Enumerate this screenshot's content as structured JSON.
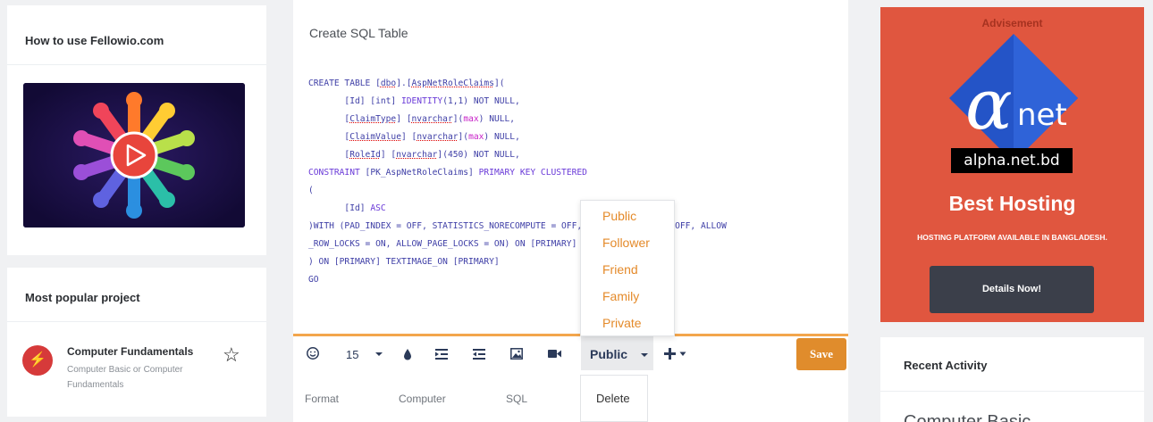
{
  "left": {
    "howto_title": "How to use Fellowio.com",
    "popular_title": "Most popular project",
    "project": {
      "icon": "bolt-icon",
      "title": "Computer Fundamentals",
      "subtitle": "Computer Basic or Computer Fundamentals"
    }
  },
  "editor": {
    "title": "Create  SQL Table",
    "code_lines": [
      "CREATE TABLE [dbo].[AspNetRoleClaims](",
      "       [Id] [int] IDENTITY(1,1) NOT NULL,",
      "       [ClaimType] [nvarchar](max) NULL,",
      "       [ClaimValue] [nvarchar](max) NULL,",
      "       [RoleId] [nvarchar](450) NOT NULL,",
      "CONSTRAINT [PK_AspNetRoleClaims] PRIMARY KEY CLUSTERED",
      "(",
      "       [Id] ASC",
      ")WITH (PAD_INDEX = OFF, STATISTICS_NORECOMPUTE = OFF, IGNORE_DUP_KEY = OFF, ALLOW",
      "_ROW_LOCKS = ON, ALLOW_PAGE_LOCKS = ON) ON [PRIMARY]",
      ") ON [PRIMARY] TEXTIMAGE_ON [PRIMARY]",
      "GO"
    ],
    "toolbar": {
      "font_size": "15",
      "visibility": "Public",
      "save_label": "Save"
    },
    "categories": [
      "Format",
      "Computer",
      "SQL"
    ]
  },
  "visibility_menu": [
    "Public",
    "Follower",
    "Friend",
    "Family",
    "Private"
  ],
  "delete_label": "Delete",
  "ad": {
    "label": "Advisement",
    "domain": "alpha.net.bd",
    "headline": "Best Hosting",
    "tagline": "HOSTING PLATFORM AVAILABLE IN BANGLADESH.",
    "cta": "Details Now!",
    "bg_color": "#e0563f"
  },
  "recent": {
    "title": "Recent Activity",
    "peek": "Computer Basic"
  },
  "colors": {
    "accent": "#e08c2c",
    "menu_text": "#e48a2a"
  }
}
